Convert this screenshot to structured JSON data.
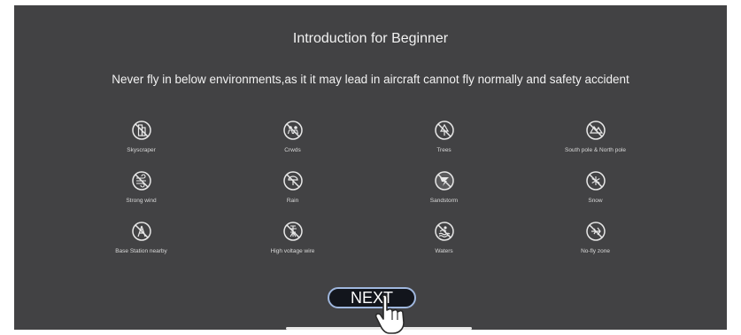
{
  "title": "Introduction for Beginner",
  "subtitle": "Never fly in below environments,as it it may lead in aircraft cannot fly normally and safety accident",
  "items": [
    {
      "label": "Skyscraper",
      "icon": "skyscraper-prohibited-icon"
    },
    {
      "label": "Crwds",
      "icon": "crowds-prohibited-icon"
    },
    {
      "label": "Trees",
      "icon": "trees-prohibited-icon"
    },
    {
      "label": "South pole & North pole",
      "icon": "poles-prohibited-icon"
    },
    {
      "label": "Strong wind",
      "icon": "strong-wind-prohibited-icon"
    },
    {
      "label": "Rain",
      "icon": "rain-prohibited-icon"
    },
    {
      "label": "Sandstorm",
      "icon": "sandstorm-prohibited-icon"
    },
    {
      "label": "Snow",
      "icon": "snow-prohibited-icon"
    },
    {
      "label": "Base Station nearby",
      "icon": "base-station-prohibited-icon"
    },
    {
      "label": "High voltage wire",
      "icon": "high-voltage-wire-prohibited-icon"
    },
    {
      "label": "Waters",
      "icon": "waters-prohibited-icon"
    },
    {
      "label": "No-fly zone",
      "icon": "no-fly-zone-prohibited-icon"
    }
  ],
  "next_button": {
    "label": "NEXT"
  },
  "colors": {
    "background": "#424244",
    "text": "#f2f2f2",
    "button_border": "#9fb7de",
    "button_fill": "#12151c"
  }
}
